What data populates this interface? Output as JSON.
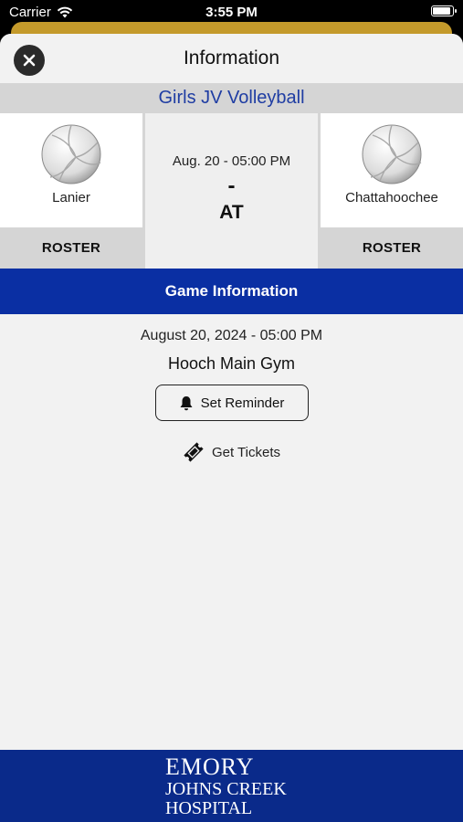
{
  "status_bar": {
    "carrier": "Carrier",
    "time": "3:55 PM"
  },
  "header": {
    "title": "Information"
  },
  "sport": {
    "title": "Girls JV Volleyball"
  },
  "game": {
    "home": {
      "name": "Lanier",
      "roster_label": "ROSTER",
      "icon": "volleyball-icon"
    },
    "away": {
      "name": "Chattahoochee",
      "roster_label": "ROSTER",
      "icon": "volleyball-icon"
    },
    "datetime": "Aug. 20 - 05:00 PM",
    "score": "-",
    "vs": "AT"
  },
  "info": {
    "section_title": "Game Information",
    "date": "August 20, 2024 - 05:00 PM",
    "venue": "Hooch Main Gym",
    "reminder_label": "Set Reminder",
    "tickets_label": "Get Tickets"
  },
  "sponsor": {
    "line1": "EMORY",
    "line2": "JOHNS CREEK",
    "line3": "HOSPITAL"
  },
  "colors": {
    "accent_blue": "#0a2fa3",
    "sport_title": "#1f3da3",
    "gold": "#c49a2b"
  }
}
